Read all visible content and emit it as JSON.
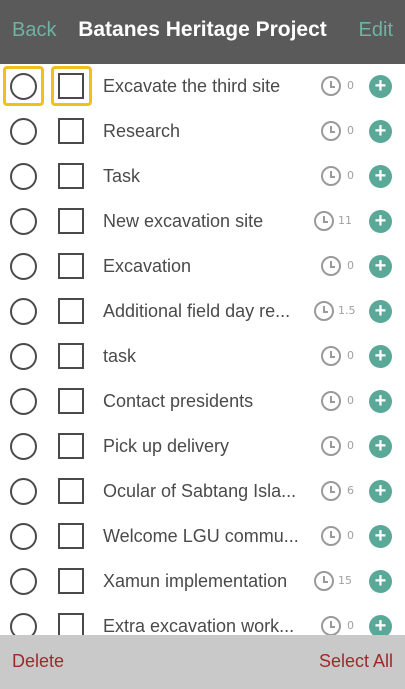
{
  "header": {
    "back_label": "Back",
    "title": "Batanes Heritage Project",
    "edit_label": "Edit"
  },
  "tasks": [
    {
      "label": "Excavate the third site",
      "count": "0"
    },
    {
      "label": "Research",
      "count": "0"
    },
    {
      "label": "Task",
      "count": "0"
    },
    {
      "label": "New excavation site",
      "count": "11"
    },
    {
      "label": "Excavation",
      "count": "0"
    },
    {
      "label": "Additional field day re...",
      "count": "1.5"
    },
    {
      "label": "task",
      "count": "0"
    },
    {
      "label": "Contact presidents",
      "count": "0"
    },
    {
      "label": "Pick up delivery",
      "count": "0"
    },
    {
      "label": "Ocular of Sabtang Isla...",
      "count": "6"
    },
    {
      "label": "Welcome LGU commu...",
      "count": "0"
    },
    {
      "label": "Xamun implementation",
      "count": "15"
    },
    {
      "label": "Extra excavation work...",
      "count": "0"
    }
  ],
  "footer": {
    "delete_label": "Delete",
    "select_all_label": "Select All"
  },
  "colors": {
    "header_bg": "#5a5a5a",
    "accent": "#5aa898",
    "highlight": "#f0c020",
    "footer_bg": "#c9c9c9",
    "footer_text": "#9c2a2a"
  }
}
